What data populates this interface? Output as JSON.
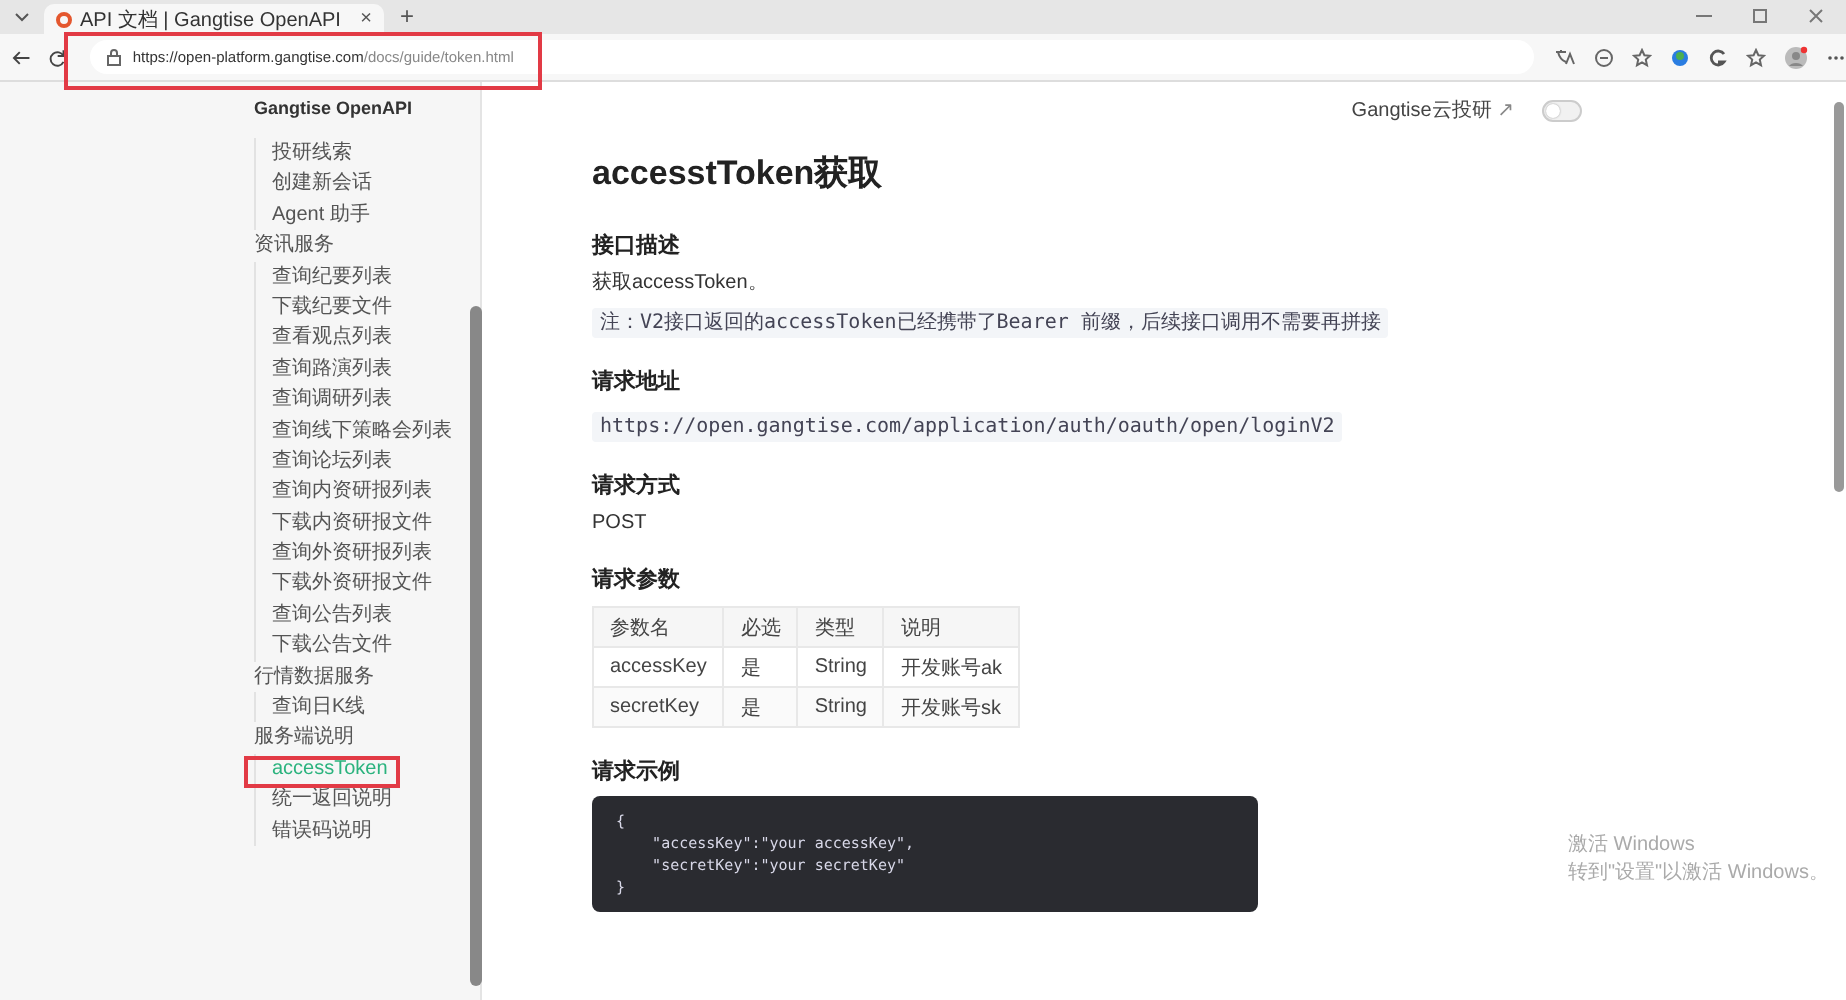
{
  "browser": {
    "tab_title": "API 文档 | Gangtise OpenAPI",
    "close_tab": "×",
    "new_tab": "+",
    "url_host": "https://open-platform.gangtise.com",
    "url_path": "/docs/guide/token.html"
  },
  "sidebar": {
    "title": "Gangtise OpenAPI",
    "groups": [
      {
        "items": [
          {
            "label": "投研线索",
            "selected": false
          },
          {
            "label": "创建新会话",
            "selected": false
          },
          {
            "label": "Agent 助手",
            "selected": false
          }
        ]
      },
      {
        "title": "资讯服务",
        "items": [
          {
            "label": "查询纪要列表",
            "selected": false
          },
          {
            "label": "下载纪要文件",
            "selected": false
          },
          {
            "label": "查看观点列表",
            "selected": false
          },
          {
            "label": "查询路演列表",
            "selected": false
          },
          {
            "label": "查询调研列表",
            "selected": false
          },
          {
            "label": "查询线下策略会列表",
            "selected": false
          },
          {
            "label": "查询论坛列表",
            "selected": false
          },
          {
            "label": "查询内资研报列表",
            "selected": false
          },
          {
            "label": "下载内资研报文件",
            "selected": false
          },
          {
            "label": "查询外资研报列表",
            "selected": false
          },
          {
            "label": "下载外资研报文件",
            "selected": false
          },
          {
            "label": "查询公告列表",
            "selected": false
          },
          {
            "label": "下载公告文件",
            "selected": false
          }
        ]
      },
      {
        "title": "行情数据服务",
        "items": [
          {
            "label": "查询日K线",
            "selected": false
          }
        ]
      },
      {
        "title": "服务端说明",
        "items": [
          {
            "label": "accessToken",
            "selected": true
          },
          {
            "label": "统一返回说明",
            "selected": false
          },
          {
            "label": "错误码说明",
            "selected": false
          }
        ]
      }
    ]
  },
  "topbar": {
    "link": "Gangtise云投研",
    "link_icon": "↗",
    "dark_mode": false
  },
  "page": {
    "title": "accesstToken获取",
    "sections": [
      {
        "heading": "接口描述",
        "kind": "text",
        "text": "获取accessToken。",
        "note": "注：V2接口返回的accessToken已经携带了Bearer 前缀，后续接口调用不需要再拼接"
      },
      {
        "heading": "请求地址",
        "kind": "code_inline",
        "text": "https://open.gangtise.com/application/auth/oauth/open/loginV2"
      },
      {
        "heading": "请求方式",
        "kind": "text",
        "text": "POST"
      },
      {
        "heading": "请求参数",
        "kind": "table",
        "columns": [
          "参数名",
          "必选",
          "类型",
          "说明"
        ],
        "rows": [
          [
            "accessKey",
            "是",
            "String",
            "开发账号ak"
          ],
          [
            "secretKey",
            "是",
            "String",
            "开发账号sk"
          ]
        ]
      },
      {
        "heading": "请求示例",
        "kind": "code_block",
        "lines": [
          "{",
          "    \"accessKey\":\"your accessKey\",",
          "    \"secretKey\":\"your secretKey\"",
          "}"
        ]
      }
    ]
  },
  "os_notice": {
    "title": "激活 Windows",
    "text": "转到\"设置\"以激活 Windows。"
  }
}
